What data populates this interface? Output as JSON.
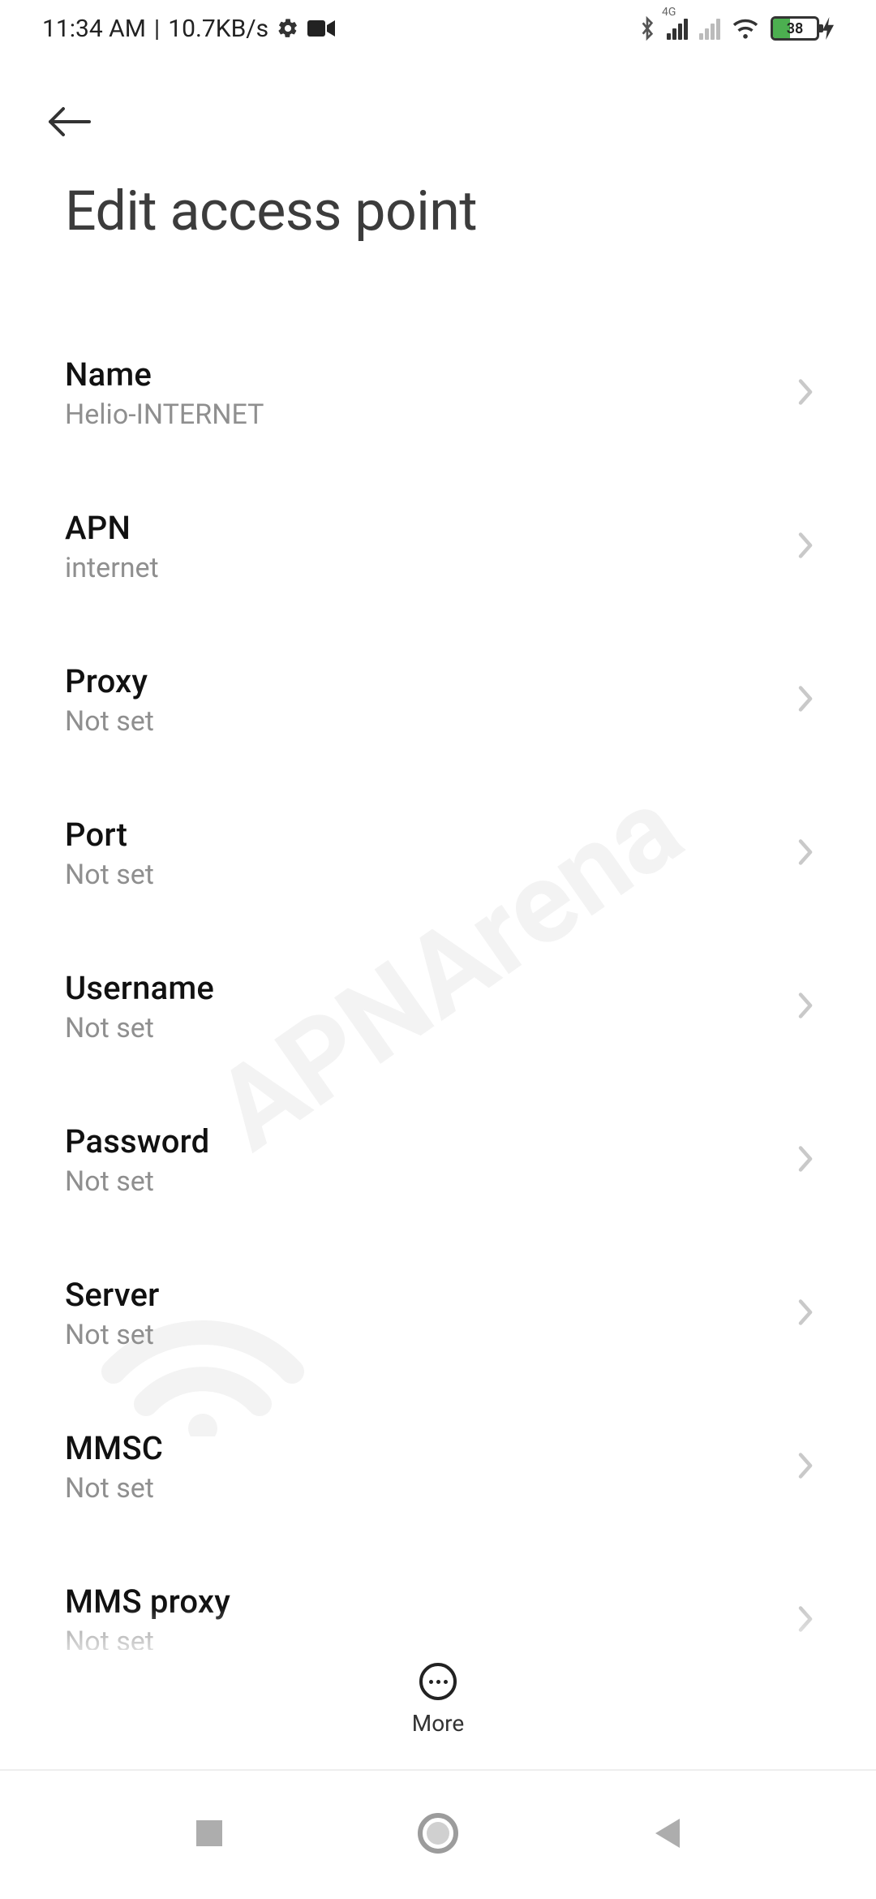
{
  "statusbar": {
    "time": "11:34 AM",
    "speed": "10.7KB/s",
    "network_badge": "4G",
    "battery_pct": 38,
    "battery_text": "38"
  },
  "header": {
    "title": "Edit access point"
  },
  "items": [
    {
      "label": "Name",
      "value": "Helio-INTERNET"
    },
    {
      "label": "APN",
      "value": "internet"
    },
    {
      "label": "Proxy",
      "value": "Not set"
    },
    {
      "label": "Port",
      "value": "Not set"
    },
    {
      "label": "Username",
      "value": "Not set"
    },
    {
      "label": "Password",
      "value": "Not set"
    },
    {
      "label": "Server",
      "value": "Not set"
    },
    {
      "label": "MMSC",
      "value": "Not set"
    },
    {
      "label": "MMS proxy",
      "value": "Not set"
    }
  ],
  "bottom": {
    "more_label": "More"
  },
  "watermark": {
    "text": "APNArena"
  }
}
